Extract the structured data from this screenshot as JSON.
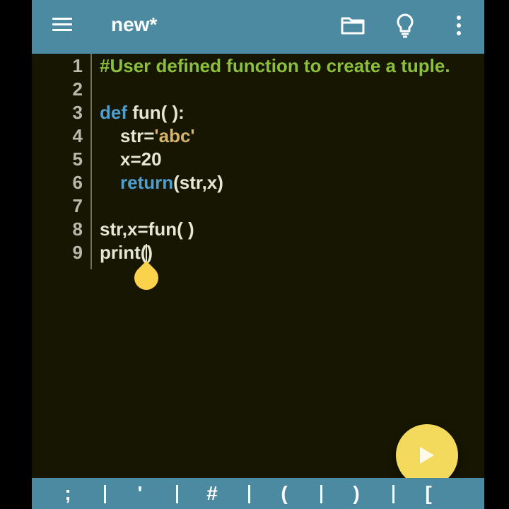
{
  "app_bar": {
    "menu_icon": "hamburger-menu-icon",
    "title": "new*",
    "actions": [
      "folder-icon",
      "lightbulb-icon",
      "more-vert-icon"
    ]
  },
  "editor": {
    "lines": [
      {
        "number": "1",
        "segments": [
          {
            "type": "comment",
            "text": "#User defined function to create a tuple."
          }
        ]
      },
      {
        "number": "2",
        "segments": []
      },
      {
        "number": "3",
        "segments": [
          {
            "type": "keyword",
            "text": "def"
          },
          {
            "type": "plain",
            "text": " fun( ):"
          }
        ]
      },
      {
        "number": "4",
        "segments": [
          {
            "type": "plain",
            "text": "str="
          },
          {
            "type": "string",
            "text": "'abc'"
          }
        ]
      },
      {
        "number": "5",
        "segments": [
          {
            "type": "plain",
            "text": "x=20"
          }
        ]
      },
      {
        "number": "6",
        "segments": [
          {
            "type": "keyword",
            "text": "return"
          },
          {
            "type": "plain",
            "text": "(str,x)"
          }
        ]
      },
      {
        "number": "7",
        "segments": []
      },
      {
        "number": "8",
        "segments": [
          {
            "type": "plain",
            "text": "str,x=fun( )"
          }
        ]
      },
      {
        "number": "9",
        "segments": [
          {
            "type": "plain",
            "text": "print("
          },
          {
            "type": "plain",
            "text": ")"
          }
        ]
      }
    ]
  },
  "run_button": {
    "icon": "play-icon"
  },
  "keybar": {
    "keys": [
      ";",
      "'",
      "#",
      "(",
      ")",
      "["
    ]
  },
  "colors": {
    "app_bar": "#4c8aa1",
    "editor_bg": "#161602",
    "comment": "#8bbf3c",
    "keyword": "#4e9fd0",
    "string": "#d9b36b",
    "fab": "#f3da5c"
  }
}
